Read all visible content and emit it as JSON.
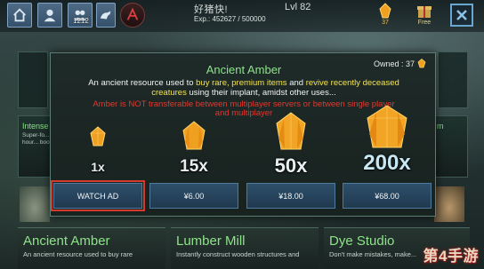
{
  "topbar": {
    "tribe_count": "1212",
    "player_name": "好猪快!",
    "level": "Lvl 82",
    "xp": "Exp.: 452627 / 500000",
    "amber_label": "37",
    "gift_label": "Free"
  },
  "modal": {
    "title": "Ancient Amber",
    "owned": "Owned : 37",
    "desc_1": "An ancient resource used to ",
    "desc_hl_1": "buy rare, premium items",
    "desc_2": " and ",
    "desc_hl_2": "revive recently deceased creatures",
    "desc_3": " using their implant, amidst other uses...",
    "warning": "Amber is NOT transferable between multiplayer servers or between single player and multiplayer",
    "packs": [
      {
        "quantity": "1x",
        "button": "WATCH AD"
      },
      {
        "quantity": "15x",
        "button": "¥6.00"
      },
      {
        "quantity": "50x",
        "button": "¥18.00"
      },
      {
        "quantity": "200x",
        "button": "¥68.00"
      }
    ]
  },
  "background": {
    "left_card_title": "Intense",
    "left_card_text": "Super-fo... one hour... boost",
    "right_card_title": "m",
    "cards": [
      {
        "title": "Ancient Amber",
        "text": "An ancient resource used to buy rare"
      },
      {
        "title": "Lumber Mill",
        "text": "Instantly construct wooden structures and"
      },
      {
        "title": "Dye Studio",
        "text": "Don't make mistakes, make..."
      }
    ]
  },
  "watermark": "第4手游",
  "colors": {
    "title_green": "#8ee38a",
    "highlight_yellow": "#f3e24a",
    "warning_red": "#e2372e",
    "button_blue": "#2e4f6b",
    "amber": "#f0a020"
  },
  "icons": [
    "home-icon",
    "people-icon",
    "group-icon",
    "dino-icon",
    "amber-icon",
    "gift-icon",
    "close-icon"
  ]
}
